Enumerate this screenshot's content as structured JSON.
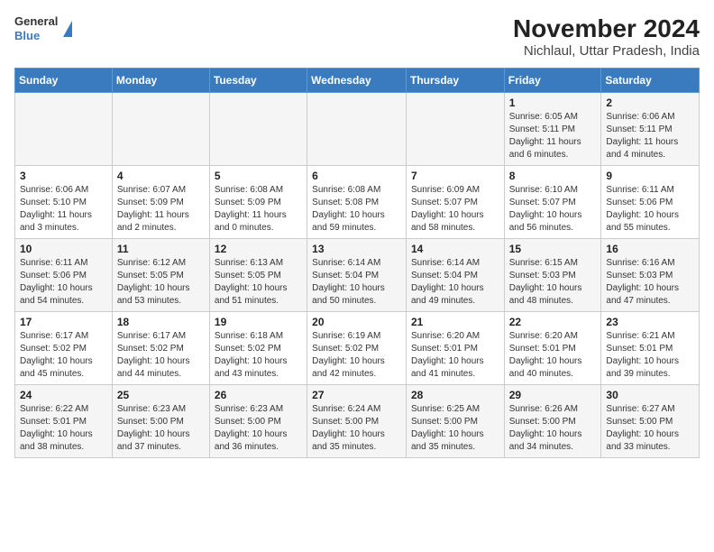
{
  "header": {
    "logo_line1": "General",
    "logo_line2": "Blue",
    "title": "November 2024",
    "subtitle": "Nichlaul, Uttar Pradesh, India"
  },
  "weekdays": [
    "Sunday",
    "Monday",
    "Tuesday",
    "Wednesday",
    "Thursday",
    "Friday",
    "Saturday"
  ],
  "weeks": [
    [
      {
        "date": "",
        "info": ""
      },
      {
        "date": "",
        "info": ""
      },
      {
        "date": "",
        "info": ""
      },
      {
        "date": "",
        "info": ""
      },
      {
        "date": "",
        "info": ""
      },
      {
        "date": "1",
        "info": "Sunrise: 6:05 AM\nSunset: 5:11 PM\nDaylight: 11 hours and 6 minutes."
      },
      {
        "date": "2",
        "info": "Sunrise: 6:06 AM\nSunset: 5:11 PM\nDaylight: 11 hours and 4 minutes."
      }
    ],
    [
      {
        "date": "3",
        "info": "Sunrise: 6:06 AM\nSunset: 5:10 PM\nDaylight: 11 hours and 3 minutes."
      },
      {
        "date": "4",
        "info": "Sunrise: 6:07 AM\nSunset: 5:09 PM\nDaylight: 11 hours and 2 minutes."
      },
      {
        "date": "5",
        "info": "Sunrise: 6:08 AM\nSunset: 5:09 PM\nDaylight: 11 hours and 0 minutes."
      },
      {
        "date": "6",
        "info": "Sunrise: 6:08 AM\nSunset: 5:08 PM\nDaylight: 10 hours and 59 minutes."
      },
      {
        "date": "7",
        "info": "Sunrise: 6:09 AM\nSunset: 5:07 PM\nDaylight: 10 hours and 58 minutes."
      },
      {
        "date": "8",
        "info": "Sunrise: 6:10 AM\nSunset: 5:07 PM\nDaylight: 10 hours and 56 minutes."
      },
      {
        "date": "9",
        "info": "Sunrise: 6:11 AM\nSunset: 5:06 PM\nDaylight: 10 hours and 55 minutes."
      }
    ],
    [
      {
        "date": "10",
        "info": "Sunrise: 6:11 AM\nSunset: 5:06 PM\nDaylight: 10 hours and 54 minutes."
      },
      {
        "date": "11",
        "info": "Sunrise: 6:12 AM\nSunset: 5:05 PM\nDaylight: 10 hours and 53 minutes."
      },
      {
        "date": "12",
        "info": "Sunrise: 6:13 AM\nSunset: 5:05 PM\nDaylight: 10 hours and 51 minutes."
      },
      {
        "date": "13",
        "info": "Sunrise: 6:14 AM\nSunset: 5:04 PM\nDaylight: 10 hours and 50 minutes."
      },
      {
        "date": "14",
        "info": "Sunrise: 6:14 AM\nSunset: 5:04 PM\nDaylight: 10 hours and 49 minutes."
      },
      {
        "date": "15",
        "info": "Sunrise: 6:15 AM\nSunset: 5:03 PM\nDaylight: 10 hours and 48 minutes."
      },
      {
        "date": "16",
        "info": "Sunrise: 6:16 AM\nSunset: 5:03 PM\nDaylight: 10 hours and 47 minutes."
      }
    ],
    [
      {
        "date": "17",
        "info": "Sunrise: 6:17 AM\nSunset: 5:02 PM\nDaylight: 10 hours and 45 minutes."
      },
      {
        "date": "18",
        "info": "Sunrise: 6:17 AM\nSunset: 5:02 PM\nDaylight: 10 hours and 44 minutes."
      },
      {
        "date": "19",
        "info": "Sunrise: 6:18 AM\nSunset: 5:02 PM\nDaylight: 10 hours and 43 minutes."
      },
      {
        "date": "20",
        "info": "Sunrise: 6:19 AM\nSunset: 5:02 PM\nDaylight: 10 hours and 42 minutes."
      },
      {
        "date": "21",
        "info": "Sunrise: 6:20 AM\nSunset: 5:01 PM\nDaylight: 10 hours and 41 minutes."
      },
      {
        "date": "22",
        "info": "Sunrise: 6:20 AM\nSunset: 5:01 PM\nDaylight: 10 hours and 40 minutes."
      },
      {
        "date": "23",
        "info": "Sunrise: 6:21 AM\nSunset: 5:01 PM\nDaylight: 10 hours and 39 minutes."
      }
    ],
    [
      {
        "date": "24",
        "info": "Sunrise: 6:22 AM\nSunset: 5:01 PM\nDaylight: 10 hours and 38 minutes."
      },
      {
        "date": "25",
        "info": "Sunrise: 6:23 AM\nSunset: 5:00 PM\nDaylight: 10 hours and 37 minutes."
      },
      {
        "date": "26",
        "info": "Sunrise: 6:23 AM\nSunset: 5:00 PM\nDaylight: 10 hours and 36 minutes."
      },
      {
        "date": "27",
        "info": "Sunrise: 6:24 AM\nSunset: 5:00 PM\nDaylight: 10 hours and 35 minutes."
      },
      {
        "date": "28",
        "info": "Sunrise: 6:25 AM\nSunset: 5:00 PM\nDaylight: 10 hours and 35 minutes."
      },
      {
        "date": "29",
        "info": "Sunrise: 6:26 AM\nSunset: 5:00 PM\nDaylight: 10 hours and 34 minutes."
      },
      {
        "date": "30",
        "info": "Sunrise: 6:27 AM\nSunset: 5:00 PM\nDaylight: 10 hours and 33 minutes."
      }
    ]
  ]
}
